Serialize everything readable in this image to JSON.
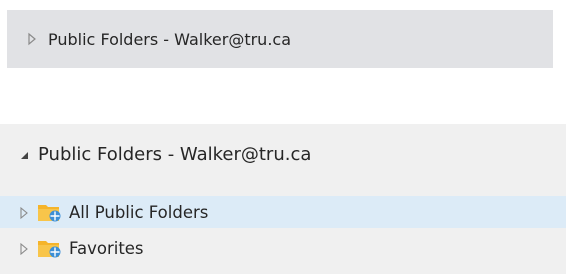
{
  "collapsed_header": {
    "label": "Public Folders - Walker@tru.ca",
    "expand_icon": "collapsed-triangle-icon",
    "background": "#e1e2e5"
  },
  "expanded_header": {
    "label": "Public Folders - Walker@tru.ca",
    "expand_icon": "expanded-triangle-icon",
    "background": "#f0f0f0"
  },
  "folders": [
    {
      "label": "All Public Folders",
      "icon": "public-folder-icon",
      "selected": true,
      "highlight": "#dcebf7"
    },
    {
      "label": "Favorites",
      "icon": "public-folder-icon",
      "selected": false
    }
  ],
  "colors": {
    "folder": "#f5b42a",
    "globe": "#3c8fd6",
    "text": "#262626"
  }
}
